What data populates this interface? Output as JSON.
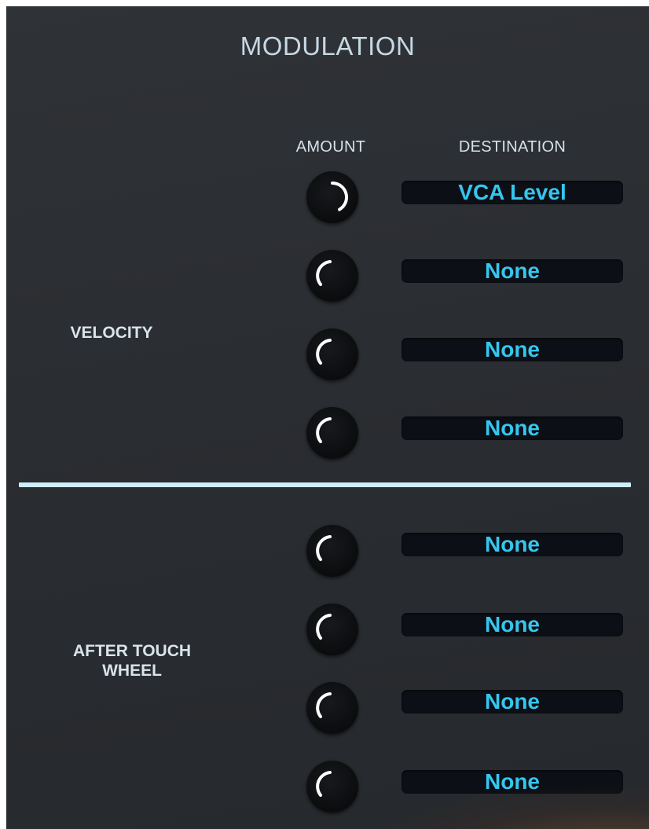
{
  "module": {
    "title": "MODULATION"
  },
  "columns": {
    "amount": "AMOUNT",
    "destination": "DESTINATION"
  },
  "colors": {
    "accent": "#35c6ee",
    "divider": "#cfeefb",
    "label": "#d9e4ea"
  },
  "sections": [
    {
      "label": "VELOCITY",
      "slots": [
        {
          "destination": "VCA Level",
          "amount_icon": "knob-icon"
        },
        {
          "destination": "None",
          "amount_icon": "knob-icon"
        },
        {
          "destination": "None",
          "amount_icon": "knob-icon"
        },
        {
          "destination": "None",
          "amount_icon": "knob-icon"
        }
      ]
    },
    {
      "label": "AFTER TOUCH\nWHEEL",
      "label_lines": [
        "AFTER TOUCH",
        "WHEEL"
      ],
      "slots": [
        {
          "destination": "None",
          "amount_icon": "knob-icon"
        },
        {
          "destination": "None",
          "amount_icon": "knob-icon"
        },
        {
          "destination": "None",
          "amount_icon": "knob-icon"
        },
        {
          "destination": "None",
          "amount_icon": "knob-icon"
        }
      ]
    }
  ]
}
